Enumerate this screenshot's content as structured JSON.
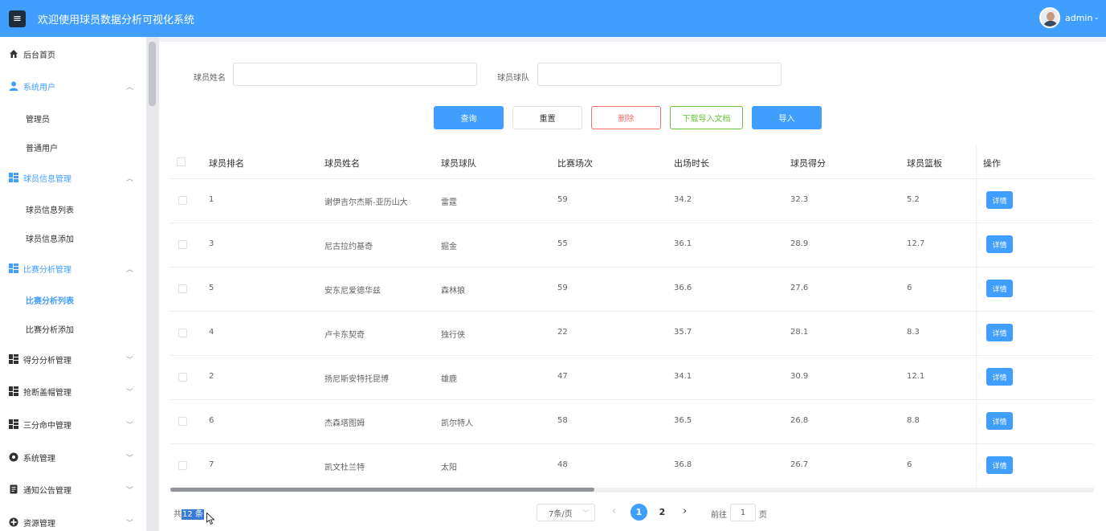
{
  "header": {
    "title": "欢迎使用球员数据分析可视化系统",
    "menu_icon": "≡",
    "username": "admin",
    "dropdown_icon": "⌄"
  },
  "sidebar": {
    "home": "后台首页",
    "groups": [
      {
        "label": "系统用户",
        "icon": "user-icon",
        "expanded": true,
        "children": [
          "管理员",
          "普通用户"
        ]
      },
      {
        "label": "球员信息管理",
        "icon": "grid-icon",
        "expanded": true,
        "children": [
          "球员信息列表",
          "球员信息添加"
        ]
      },
      {
        "label": "比赛分析管理",
        "icon": "grid-icon",
        "expanded": true,
        "children": [
          "比赛分析列表",
          "比赛分析添加"
        ],
        "active_child": "比赛分析列表"
      },
      {
        "label": "得分分析管理",
        "icon": "grid-icon",
        "expanded": false,
        "children": []
      },
      {
        "label": "抢断盖帽管理",
        "icon": "grid-icon",
        "expanded": false,
        "children": []
      },
      {
        "label": "三分命中管理",
        "icon": "grid-icon",
        "expanded": false,
        "children": []
      },
      {
        "label": "系统管理",
        "icon": "gear-icon",
        "expanded": false,
        "children": []
      },
      {
        "label": "通知公告管理",
        "icon": "document-icon",
        "expanded": false,
        "children": []
      },
      {
        "label": "资源管理",
        "icon": "plus-circle-icon",
        "expanded": false,
        "children": []
      }
    ]
  },
  "search": {
    "name_label": "球员姓名",
    "name_value": "",
    "team_label": "球员球队",
    "team_value": ""
  },
  "buttons": {
    "query": "查询",
    "reset": "重置",
    "delete": "删除",
    "download": "下载导入文档",
    "import": "导入"
  },
  "table": {
    "columns": [
      "球员排名",
      "球员姓名",
      "球员球队",
      "比赛场次",
      "出场时长",
      "球员得分",
      "球员篮板",
      "操作"
    ],
    "action_label": "详情",
    "rows": [
      [
        "1",
        "谢伊吉尔杰斯-亚历山大",
        "雷霆",
        "59",
        "34.2",
        "32.3",
        "5.2"
      ],
      [
        "3",
        "尼古拉约基奇",
        "掘金",
        "55",
        "36.1",
        "28.9",
        "12.7"
      ],
      [
        "5",
        "安东尼爱德华兹",
        "森林狼",
        "59",
        "36.6",
        "27.6",
        "6"
      ],
      [
        "4",
        "卢卡东契奇",
        "独行侠",
        "22",
        "35.7",
        "28.1",
        "8.3"
      ],
      [
        "2",
        "扬尼斯安特托昆博",
        "雄鹿",
        "47",
        "34.1",
        "30.9",
        "12.1"
      ],
      [
        "6",
        "杰森塔图姆",
        "凯尔特人",
        "58",
        "36.5",
        "26.8",
        "8.8"
      ],
      [
        "7",
        "凯文杜兰特",
        "太阳",
        "48",
        "36.8",
        "26.7",
        "6"
      ]
    ]
  },
  "pagination": {
    "total_prefix": "共",
    "total_value": "12 条",
    "page_size": "7条/页",
    "pages": [
      "1",
      "2"
    ],
    "current_page": "1",
    "prev": "‹",
    "next": "›",
    "jump_prefix": "前往",
    "jump_value": "1",
    "jump_suffix": "页"
  },
  "colors": {
    "primary": "#409eff",
    "danger": "#f56c6c",
    "success": "#67c23a"
  }
}
